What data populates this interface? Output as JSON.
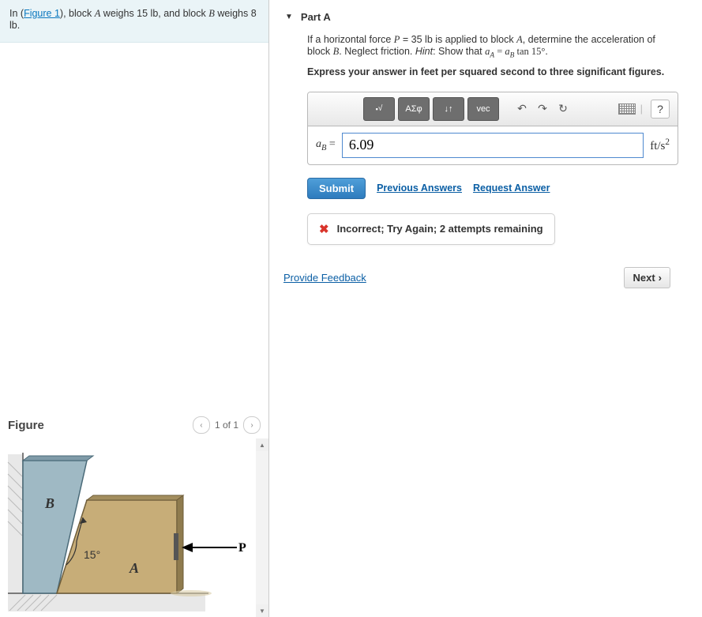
{
  "problem": {
    "prefix": "In (",
    "figure_link": "Figure 1",
    "rest": "), block A weighs 15 lb, and block B weighs 8 lb."
  },
  "figure": {
    "heading": "Figure",
    "page_label": "1 of 1",
    "labels": {
      "B": "B",
      "angle": "15°",
      "A": "A",
      "P": "P"
    }
  },
  "part": {
    "title": "Part A",
    "question_line1": "If a horizontal force P = 35 lb is applied to block A, determine the acceleration of block B. Neglect friction. ",
    "hint_label": "Hint:",
    "hint_text": " Show that a_A = a_B tan 15°.",
    "instruction": "Express your answer in feet per squared second to three significant figures."
  },
  "toolbar": {
    "templates": "x√",
    "greek": "ΑΣφ",
    "scripts": "↓↑",
    "vec": "vec",
    "undo": "↶",
    "redo": "↷",
    "reset": "↻",
    "help": "?"
  },
  "answer": {
    "label_html": "a_B =",
    "value": "6.09",
    "units_html": "ft/s²"
  },
  "actions": {
    "submit": "Submit",
    "previous": "Previous Answers",
    "request": "Request Answer"
  },
  "feedback": {
    "text": "Incorrect; Try Again; 2 attempts remaining"
  },
  "footer": {
    "provide": "Provide Feedback",
    "next": "Next"
  }
}
